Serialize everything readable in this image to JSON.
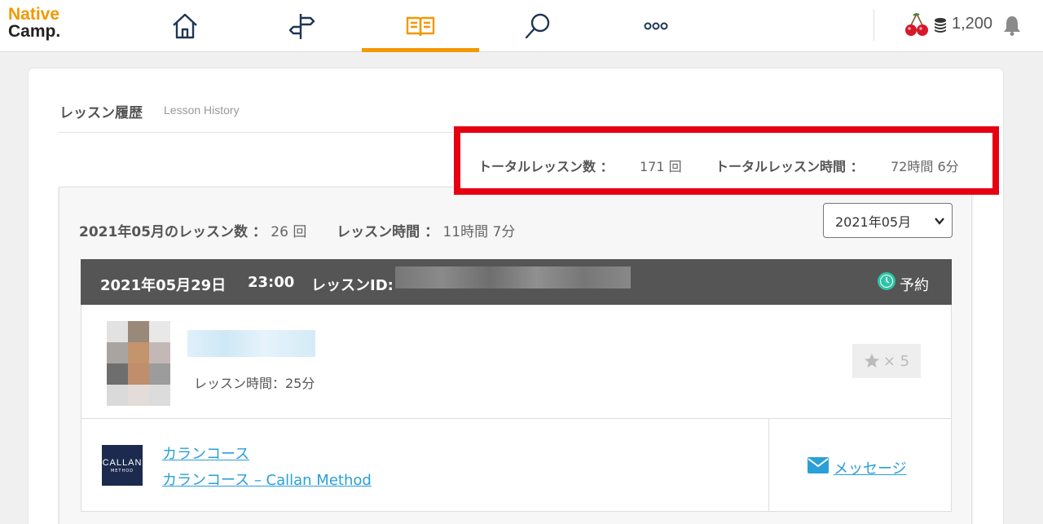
{
  "header": {
    "logo_line1": "Native",
    "logo_line2": "Camp.",
    "nav": [
      {
        "name": "home",
        "icon": "home-icon"
      },
      {
        "name": "signpost",
        "icon": "signpost-icon"
      },
      {
        "name": "book",
        "icon": "book-icon",
        "active": true
      },
      {
        "name": "search",
        "icon": "search-icon"
      },
      {
        "name": "more",
        "icon": "more-icon"
      }
    ],
    "points": "1,200",
    "accent_color": "#f39800"
  },
  "page": {
    "title": "レッスン履歴",
    "subtitle": "Lesson History"
  },
  "totals": {
    "count_label": "トータルレッスン数 ：",
    "count_value": "171 回",
    "time_label": "トータルレッスン時間 ：",
    "time_value": "72時間 6分",
    "highlight_color": "#e60012"
  },
  "month": {
    "count_label": "2021年05月のレッスン数 ：",
    "count_value": "26 回",
    "time_label": "レッスン時間 ：",
    "time_value": "11時間 7分",
    "selected": "2021年05月"
  },
  "lesson": {
    "date": "2021年05月29日",
    "time": "23:00",
    "id_label": "レッスンID:",
    "status": "予約",
    "duration": "レッスン時間：25分",
    "rating": "× 5",
    "course_logo_text": "CALLAN",
    "course_logo_sub": "METHOD",
    "course_name": "カランコース",
    "course_full": "カランコース – Callan Method",
    "message": "メッセージ"
  }
}
